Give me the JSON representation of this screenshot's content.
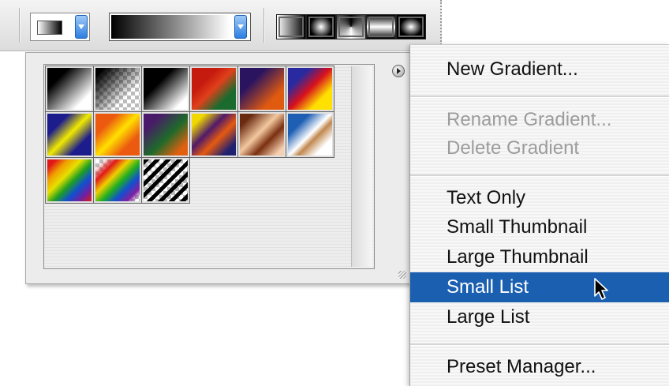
{
  "options_bar": {
    "swatch_icon": "gradient-swatch-icon",
    "dropdown_icon": "chevron-down-icon",
    "gradient_types": [
      "linear-gradient-icon",
      "radial-gradient-icon",
      "angle-gradient-icon",
      "reflected-gradient-icon",
      "diamond-gradient-icon"
    ]
  },
  "panel": {
    "menu_icon": "panel-menu-arrow-icon",
    "swatches": [
      {
        "name": "black-white"
      },
      {
        "name": "black-transparent"
      },
      {
        "name": "black-white-2"
      },
      {
        "name": "red-green"
      },
      {
        "name": "violet-orange"
      },
      {
        "name": "blue-red-yellow"
      },
      {
        "name": "blue-yellow-blue"
      },
      {
        "name": "orange-yellow-orange"
      },
      {
        "name": "violet-green-orange"
      },
      {
        "name": "yellow-violet-orange-blue"
      },
      {
        "name": "copper"
      },
      {
        "name": "chrome"
      },
      {
        "name": "spectrum"
      },
      {
        "name": "transparent-rainbow"
      },
      {
        "name": "transparent-stripes"
      }
    ]
  },
  "menu": {
    "items": [
      {
        "label": "New Gradient...",
        "enabled": true
      },
      {
        "label": "Rename Gradient...",
        "enabled": false
      },
      {
        "label": "Delete Gradient",
        "enabled": false
      },
      {
        "label": "Text Only",
        "enabled": true
      },
      {
        "label": "Small Thumbnail",
        "enabled": true
      },
      {
        "label": "Large Thumbnail",
        "enabled": true
      },
      {
        "label": "Small List",
        "enabled": true,
        "selected": true
      },
      {
        "label": "Large List",
        "enabled": true
      },
      {
        "label": "Preset Manager...",
        "enabled": true
      }
    ],
    "selected_color": "#1a5fb0"
  }
}
